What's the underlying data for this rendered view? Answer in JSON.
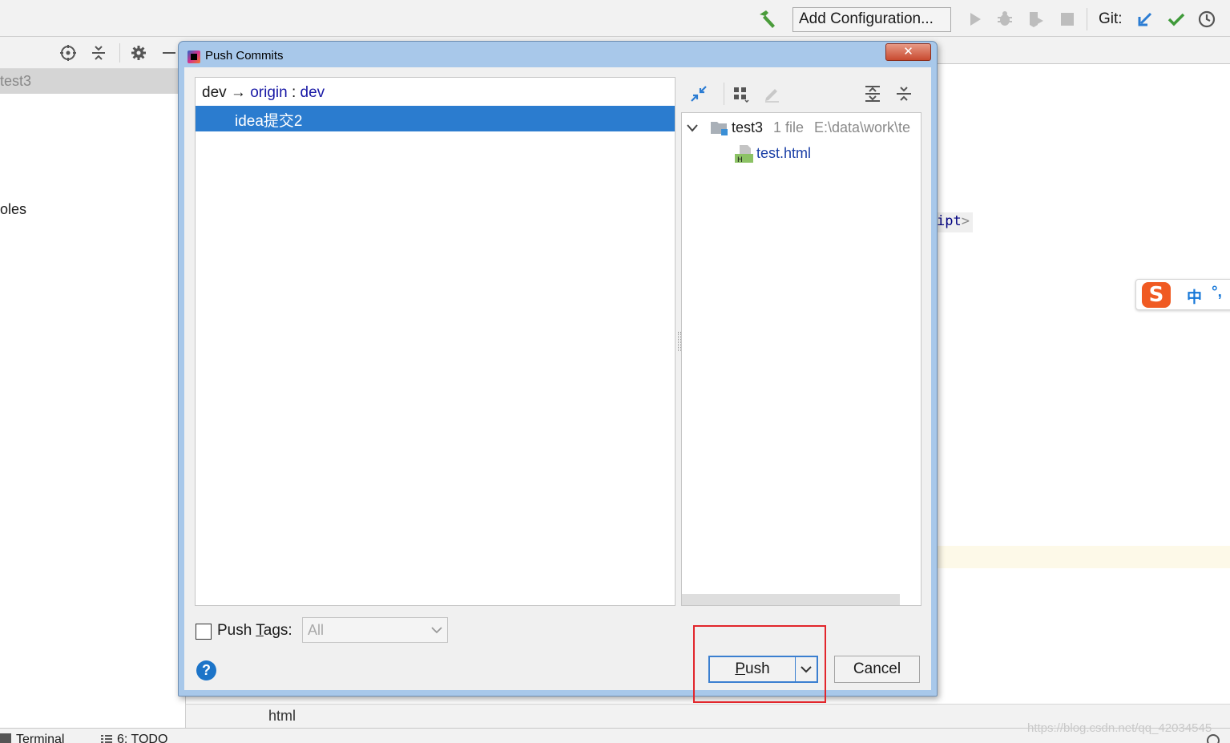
{
  "toolbar": {
    "add_configuration": "Add Configuration...",
    "git_label": "Git:"
  },
  "project_panel": {
    "selected_item": "test3",
    "item_fragment": "oles"
  },
  "editor": {
    "code_fragment": "ipt",
    "code_bracket": ">",
    "file_type": "html"
  },
  "ime": {
    "mode": "中",
    "punct": "°,"
  },
  "bottom_bar": {
    "terminal": "Terminal",
    "todo": "6: TODO"
  },
  "watermark": "https://blog.csdn.net/qq_42034545",
  "dialog": {
    "title": "Push Commits",
    "close": "✕",
    "branch": {
      "local": "dev",
      "arrow": "→",
      "remote": "origin",
      "separator": ":",
      "remote_branch": "dev"
    },
    "commits": [
      {
        "message": "idea提交2"
      }
    ],
    "file_tree": {
      "repo": "test3",
      "count": "1 file",
      "path": "E:\\data\\work\\te",
      "files": [
        {
          "name": "test.html"
        }
      ]
    },
    "push_tags": {
      "label_prefix": "Push ",
      "label_mnemonic": "T",
      "label_suffix": "ags:",
      "checked": false,
      "select_value": "All"
    },
    "help": "?",
    "push_button": {
      "mnemonic": "P",
      "rest": "ush"
    },
    "cancel_button": "Cancel"
  },
  "colors": {
    "selection": "#2b7ccf",
    "title_bar": "#a8c8ea",
    "close_button": "#c84a30",
    "highlight_box": "#e2262c",
    "link_blue": "#1a1aa6"
  }
}
